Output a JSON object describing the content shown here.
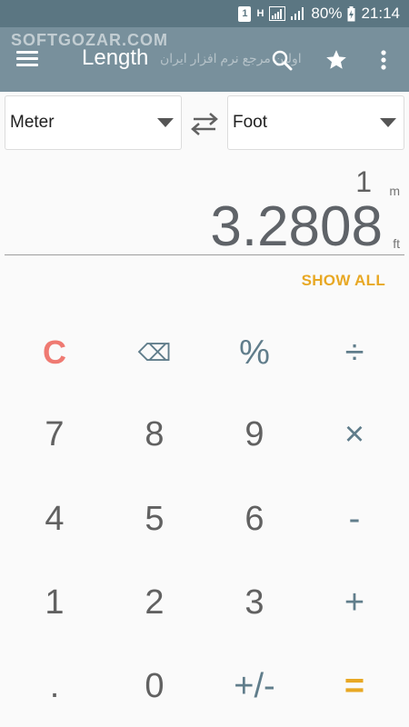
{
  "status_bar": {
    "sim": "1",
    "network": "H",
    "battery": "80%",
    "time": "21:14"
  },
  "app_bar": {
    "watermark": "SOFTGOZAR.COM",
    "watermark_sub": "اولین مرجع نرم افزار ایران",
    "title": "Length",
    "icons": [
      "menu-icon",
      "search-icon",
      "star-icon",
      "more-vert-icon"
    ]
  },
  "converter": {
    "from_unit": "Meter",
    "to_unit": "Foot",
    "source_value": "1",
    "source_unit_symbol": "m",
    "result_value": "3.2808",
    "result_unit_symbol": "ft",
    "show_all_label": "SHOW ALL"
  },
  "keypad": {
    "rows": [
      [
        "C",
        "⌫",
        "%",
        "÷"
      ],
      [
        "7",
        "8",
        "9",
        "×"
      ],
      [
        "4",
        "5",
        "6",
        "-"
      ],
      [
        "1",
        "2",
        "3",
        "+"
      ],
      [
        ".",
        "0",
        "+/-",
        "="
      ]
    ]
  },
  "colors": {
    "status_bar": "#5b7682",
    "app_bar": "#78909c",
    "accent": "#e8a824",
    "clear_key": "#ef7a72",
    "operator": "#607d8b"
  }
}
